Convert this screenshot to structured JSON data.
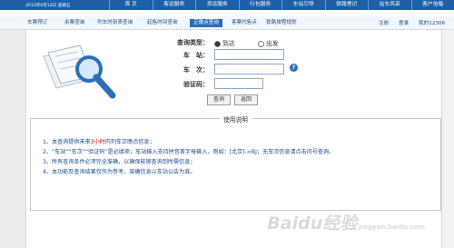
{
  "topbar": {
    "date": "2013年9月12日 星期五",
    "nav": [
      "首 页",
      "客运服务",
      "货运服务",
      "行包服务",
      "车站引导",
      "铁路常识",
      "站车风采",
      "客户信箱"
    ]
  },
  "subnav": {
    "items": [
      "车票预订",
      "余票查询",
      "列车时刻表查询",
      "起售时间查询",
      "正晚点查询",
      "客票代售点",
      "铁路旅程规划"
    ],
    "active": "正晚点查询",
    "right_links": [
      "注册",
      "登录",
      "我的12306"
    ]
  },
  "form": {
    "query_type_label": "查询类型：",
    "radio_arrive": "到达",
    "radio_depart": "出发",
    "station_label": "车　站：",
    "train_label": "车　次：",
    "captcha_label": "验证码：",
    "help_icon": "?",
    "query_button": "查询",
    "back_button": "返回"
  },
  "instructions": {
    "title": "使用说明",
    "items": [
      {
        "num": "1、",
        "pre": "本查询提供未来",
        "highlight": "3小时",
        "post": "内列车正晚点信息；"
      },
      {
        "num": "2、",
        "text": "“车站”“车次”“验证码”是必填项；车站输入支持拼音首字母输入，例如：[北京]->BJ；无车次信息请点击问号查询。"
      },
      {
        "num": "3、",
        "text": "所有查询条件必须完全准确，以确保能够查询到所需信息；"
      },
      {
        "num": "4、",
        "text": "本功能及查询结果仅作为参考，准确信息以车站公告为准。"
      }
    ]
  },
  "watermark": {
    "text": "Baidu经验",
    "sub": "jingyan.baidu.com"
  }
}
